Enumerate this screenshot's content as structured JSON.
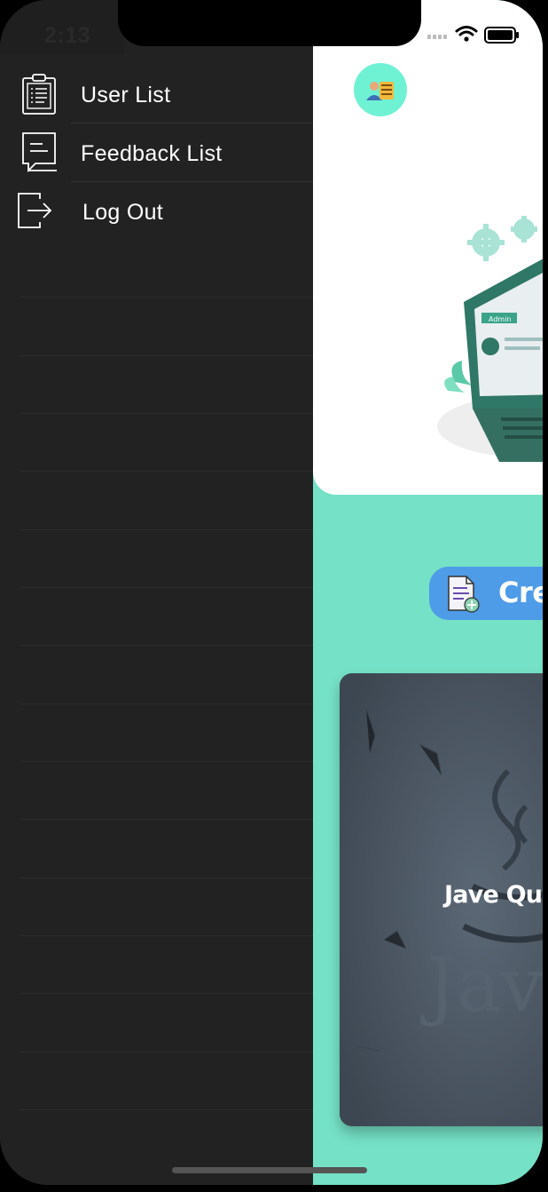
{
  "status_bar": {
    "time": "2:13",
    "signal_icon": "cellular-signal-icon",
    "wifi_icon": "wifi-icon",
    "battery_icon": "battery-icon"
  },
  "drawer": {
    "items": [
      {
        "label": "User List",
        "icon": "clipboard-list-icon"
      },
      {
        "label": "Feedback List",
        "icon": "message-feedback-icon"
      },
      {
        "label": "Log Out",
        "icon": "logout-icon"
      }
    ]
  },
  "main": {
    "avatar_icon": "admin-avatar-icon",
    "create_button": {
      "label": "Cre",
      "icon": "document-add-icon"
    },
    "quiz_card": {
      "title": "Jave Quiz",
      "watermark": "Java"
    }
  },
  "colors": {
    "drawer_bg": "#222222",
    "main_bg": "#75e1c6",
    "button_bg": "#4e9be8",
    "avatar_bg": "#6ff1d4"
  }
}
